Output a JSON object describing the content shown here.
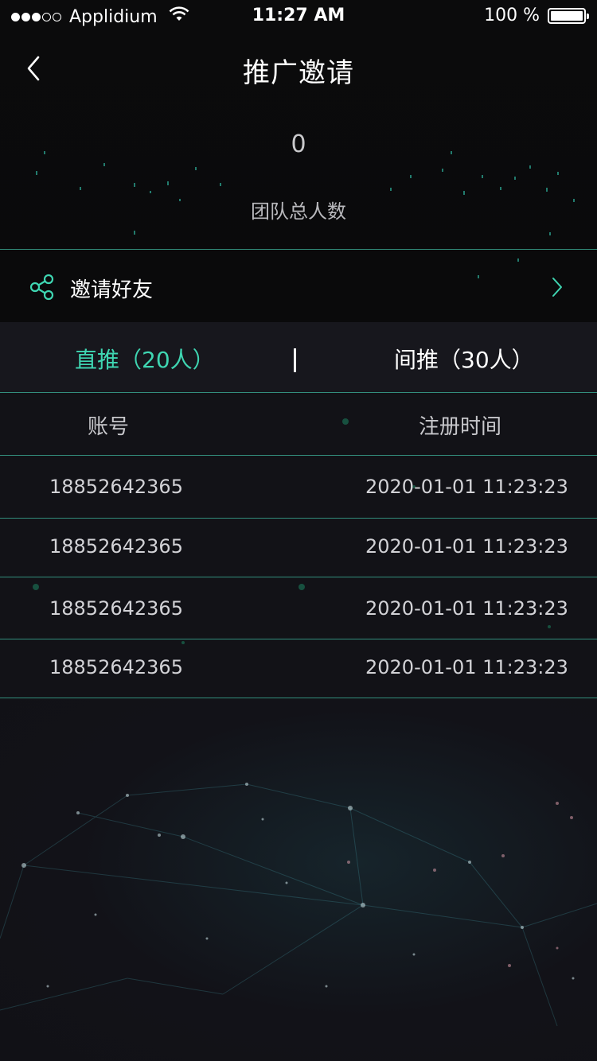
{
  "status_bar": {
    "carrier": "Applidium",
    "time": "11:27 AM",
    "battery": "100 %",
    "signal_filled": 3,
    "signal_total": 5
  },
  "nav": {
    "title": "推广邀请",
    "back_icon": "chevron-left-icon"
  },
  "team": {
    "count": "0",
    "label": "团队总人数"
  },
  "invite": {
    "label": "邀请好友",
    "icon": "share-icon",
    "arrow_icon": "chevron-right-icon"
  },
  "tabs": {
    "direct": "直推（20人）",
    "divider": "|",
    "indirect": "间推（30人）",
    "active": "direct"
  },
  "table": {
    "headers": {
      "account": "账号",
      "time": "注册时间"
    },
    "rows": [
      {
        "account": "18852642365",
        "time": "2020-01-01 11:23:23"
      },
      {
        "account": "18852642365",
        "time": "2020-01-01 11:23:23"
      },
      {
        "account": "18852642365",
        "time": "2020-01-01 11:23:23"
      },
      {
        "account": "18852642365",
        "time": "2020-01-01 11:23:23"
      }
    ]
  },
  "colors": {
    "accent": "#3fd6b2",
    "divider": "#3fb8a0",
    "background": "#121217"
  }
}
